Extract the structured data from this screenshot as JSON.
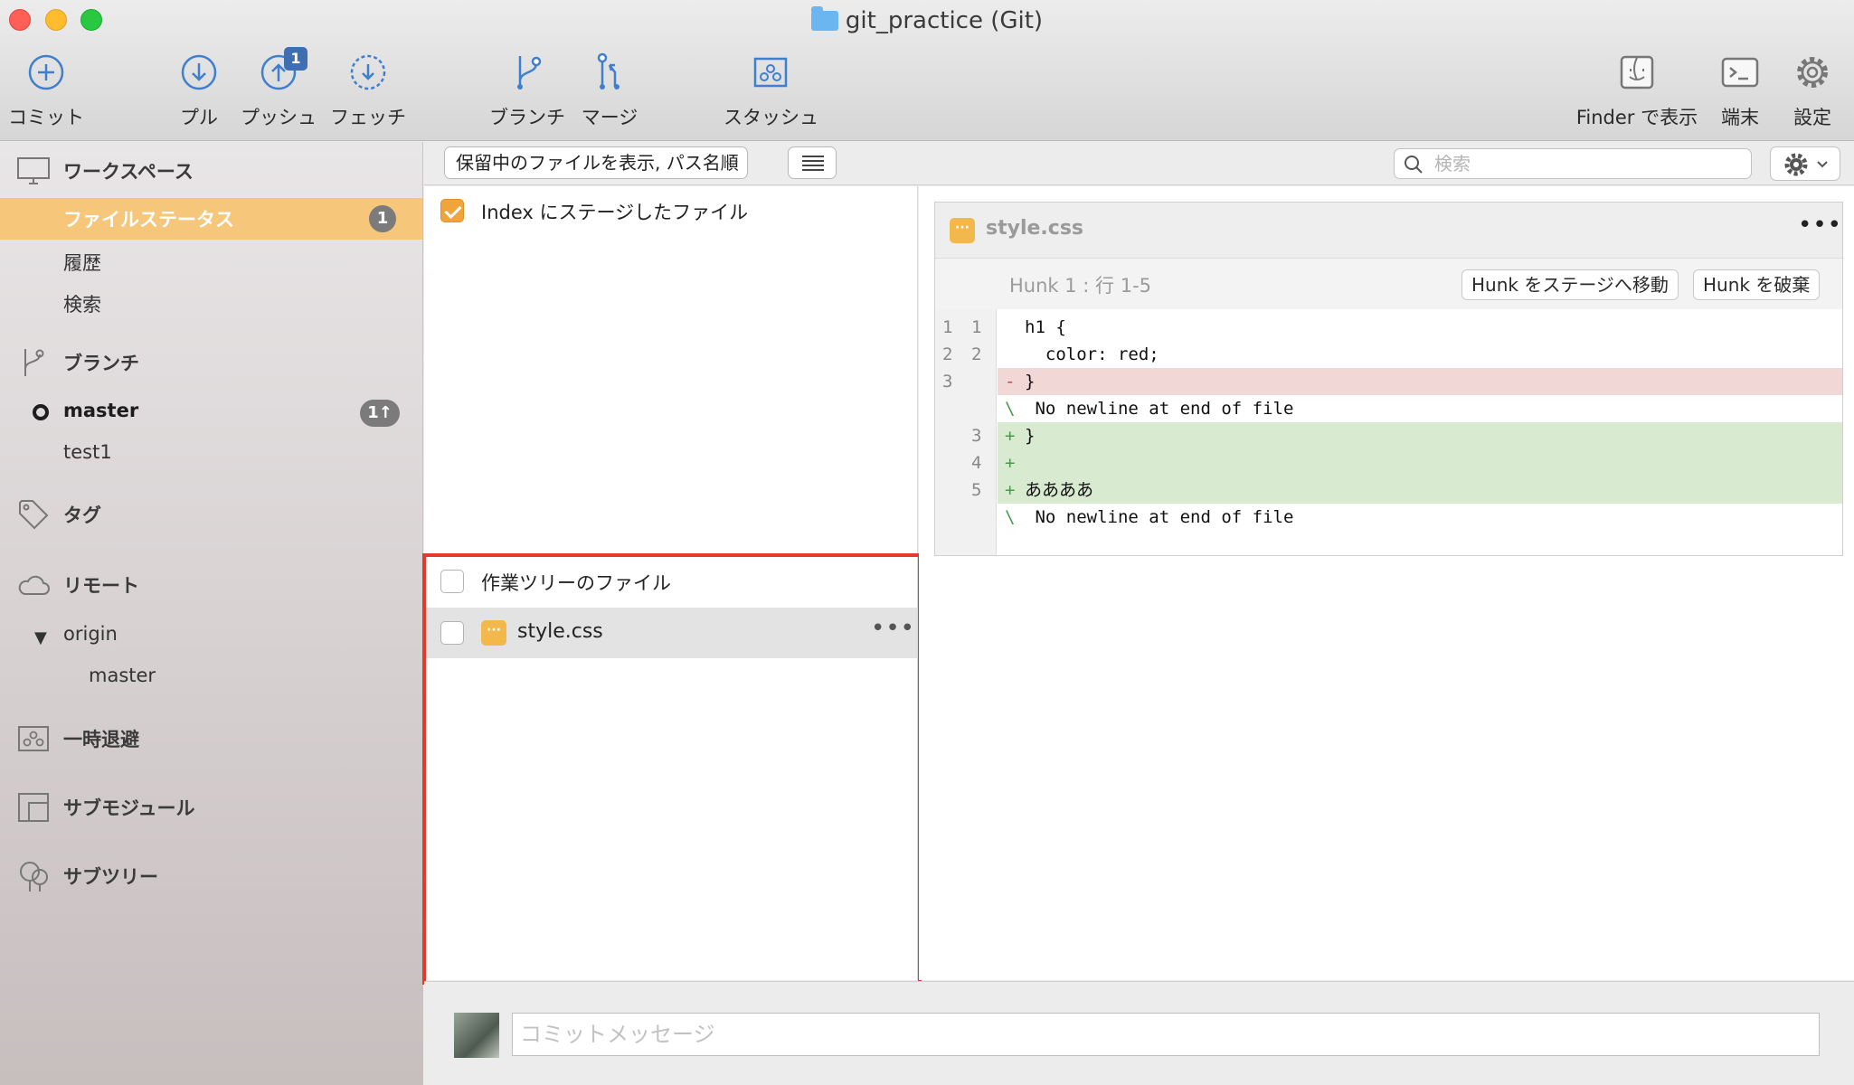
{
  "window": {
    "title": "git_practice (Git)"
  },
  "toolbar": {
    "commit": "コミット",
    "pull": "プル",
    "push": "プッシュ",
    "push_badge": "1",
    "fetch": "フェッチ",
    "branch": "ブランチ",
    "merge": "マージ",
    "stash": "スタッシュ",
    "finder": "Finder で表示",
    "terminal": "端末",
    "settings": "設定"
  },
  "sidebar": {
    "workspace": "ワークスペース",
    "file_status": "ファイルステータス",
    "file_status_count": "1",
    "history": "履歴",
    "search": "検索",
    "branches": "ブランチ",
    "branch_master": "master",
    "branch_master_badge": "1↑",
    "branch_test1": "test1",
    "tags": "タグ",
    "remotes": "リモート",
    "remote_origin": "origin",
    "remote_master": "master",
    "stashes": "一時退避",
    "submodules": "サブモジュール",
    "subtrees": "サブツリー"
  },
  "filterbar": {
    "view_mode": "保留中のファイルを表示, パス名順",
    "search_placeholder": "検索"
  },
  "staged": {
    "label": "Index にステージしたファイル"
  },
  "working_tree": {
    "label": "作業ツリーのファイル",
    "files": [
      {
        "name": "style.css"
      }
    ]
  },
  "diff": {
    "file": "style.css",
    "hunk_title": "Hunk 1 : 行 1-5",
    "stage_hunk": "Hunk をステージへ移動",
    "discard_hunk": "Hunk を破棄",
    "lines": [
      {
        "old": "1",
        "new": "1",
        "type": "ctx",
        "mark": "",
        "text": "h1 {"
      },
      {
        "old": "2",
        "new": "2",
        "type": "ctx",
        "mark": "",
        "text": "  color: red;"
      },
      {
        "old": "3",
        "new": "",
        "type": "del",
        "mark": "-",
        "text": "}"
      },
      {
        "old": "",
        "new": "",
        "type": "note",
        "mark": "\\",
        "text": " No newline at end of file"
      },
      {
        "old": "",
        "new": "3",
        "type": "add",
        "mark": "+",
        "text": "}"
      },
      {
        "old": "",
        "new": "4",
        "type": "add",
        "mark": "+",
        "text": ""
      },
      {
        "old": "",
        "new": "5",
        "type": "add",
        "mark": "+",
        "text": "ああああ"
      },
      {
        "old": "",
        "new": "",
        "type": "note",
        "mark": "\\",
        "text": " No newline at end of file"
      }
    ]
  },
  "commit": {
    "placeholder": "コミットメッセージ"
  },
  "colors": {
    "accent_orange": "#f6c67a",
    "checkbox_orange": "#f0a53a",
    "highlight_red": "#e23b2c",
    "toolbar_icon_blue": "#3f7fd0",
    "diff_added": "#d8ead0",
    "diff_removed": "#f2d7d7"
  }
}
